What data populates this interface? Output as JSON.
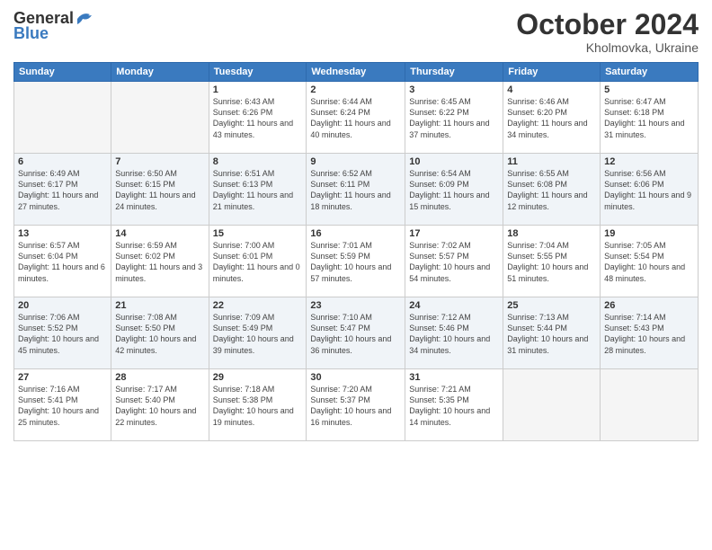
{
  "header": {
    "logo_general": "General",
    "logo_blue": "Blue",
    "month": "October 2024",
    "location": "Kholmovka, Ukraine"
  },
  "weekdays": [
    "Sunday",
    "Monday",
    "Tuesday",
    "Wednesday",
    "Thursday",
    "Friday",
    "Saturday"
  ],
  "weeks": [
    [
      {
        "day": "",
        "empty": true
      },
      {
        "day": "",
        "empty": true
      },
      {
        "day": "1",
        "sunrise": "6:43 AM",
        "sunset": "6:26 PM",
        "daylight": "11 hours and 43 minutes."
      },
      {
        "day": "2",
        "sunrise": "6:44 AM",
        "sunset": "6:24 PM",
        "daylight": "11 hours and 40 minutes."
      },
      {
        "day": "3",
        "sunrise": "6:45 AM",
        "sunset": "6:22 PM",
        "daylight": "11 hours and 37 minutes."
      },
      {
        "day": "4",
        "sunrise": "6:46 AM",
        "sunset": "6:20 PM",
        "daylight": "11 hours and 34 minutes."
      },
      {
        "day": "5",
        "sunrise": "6:47 AM",
        "sunset": "6:18 PM",
        "daylight": "11 hours and 31 minutes."
      }
    ],
    [
      {
        "day": "6",
        "sunrise": "6:49 AM",
        "sunset": "6:17 PM",
        "daylight": "11 hours and 27 minutes."
      },
      {
        "day": "7",
        "sunrise": "6:50 AM",
        "sunset": "6:15 PM",
        "daylight": "11 hours and 24 minutes."
      },
      {
        "day": "8",
        "sunrise": "6:51 AM",
        "sunset": "6:13 PM",
        "daylight": "11 hours and 21 minutes."
      },
      {
        "day": "9",
        "sunrise": "6:52 AM",
        "sunset": "6:11 PM",
        "daylight": "11 hours and 18 minutes."
      },
      {
        "day": "10",
        "sunrise": "6:54 AM",
        "sunset": "6:09 PM",
        "daylight": "11 hours and 15 minutes."
      },
      {
        "day": "11",
        "sunrise": "6:55 AM",
        "sunset": "6:08 PM",
        "daylight": "11 hours and 12 minutes."
      },
      {
        "day": "12",
        "sunrise": "6:56 AM",
        "sunset": "6:06 PM",
        "daylight": "11 hours and 9 minutes."
      }
    ],
    [
      {
        "day": "13",
        "sunrise": "6:57 AM",
        "sunset": "6:04 PM",
        "daylight": "11 hours and 6 minutes."
      },
      {
        "day": "14",
        "sunrise": "6:59 AM",
        "sunset": "6:02 PM",
        "daylight": "11 hours and 3 minutes."
      },
      {
        "day": "15",
        "sunrise": "7:00 AM",
        "sunset": "6:01 PM",
        "daylight": "11 hours and 0 minutes."
      },
      {
        "day": "16",
        "sunrise": "7:01 AM",
        "sunset": "5:59 PM",
        "daylight": "10 hours and 57 minutes."
      },
      {
        "day": "17",
        "sunrise": "7:02 AM",
        "sunset": "5:57 PM",
        "daylight": "10 hours and 54 minutes."
      },
      {
        "day": "18",
        "sunrise": "7:04 AM",
        "sunset": "5:55 PM",
        "daylight": "10 hours and 51 minutes."
      },
      {
        "day": "19",
        "sunrise": "7:05 AM",
        "sunset": "5:54 PM",
        "daylight": "10 hours and 48 minutes."
      }
    ],
    [
      {
        "day": "20",
        "sunrise": "7:06 AM",
        "sunset": "5:52 PM",
        "daylight": "10 hours and 45 minutes."
      },
      {
        "day": "21",
        "sunrise": "7:08 AM",
        "sunset": "5:50 PM",
        "daylight": "10 hours and 42 minutes."
      },
      {
        "day": "22",
        "sunrise": "7:09 AM",
        "sunset": "5:49 PM",
        "daylight": "10 hours and 39 minutes."
      },
      {
        "day": "23",
        "sunrise": "7:10 AM",
        "sunset": "5:47 PM",
        "daylight": "10 hours and 36 minutes."
      },
      {
        "day": "24",
        "sunrise": "7:12 AM",
        "sunset": "5:46 PM",
        "daylight": "10 hours and 34 minutes."
      },
      {
        "day": "25",
        "sunrise": "7:13 AM",
        "sunset": "5:44 PM",
        "daylight": "10 hours and 31 minutes."
      },
      {
        "day": "26",
        "sunrise": "7:14 AM",
        "sunset": "5:43 PM",
        "daylight": "10 hours and 28 minutes."
      }
    ],
    [
      {
        "day": "27",
        "sunrise": "7:16 AM",
        "sunset": "5:41 PM",
        "daylight": "10 hours and 25 minutes."
      },
      {
        "day": "28",
        "sunrise": "7:17 AM",
        "sunset": "5:40 PM",
        "daylight": "10 hours and 22 minutes."
      },
      {
        "day": "29",
        "sunrise": "7:18 AM",
        "sunset": "5:38 PM",
        "daylight": "10 hours and 19 minutes."
      },
      {
        "day": "30",
        "sunrise": "7:20 AM",
        "sunset": "5:37 PM",
        "daylight": "10 hours and 16 minutes."
      },
      {
        "day": "31",
        "sunrise": "7:21 AM",
        "sunset": "5:35 PM",
        "daylight": "10 hours and 14 minutes."
      },
      {
        "day": "",
        "empty": true
      },
      {
        "day": "",
        "empty": true
      }
    ]
  ]
}
